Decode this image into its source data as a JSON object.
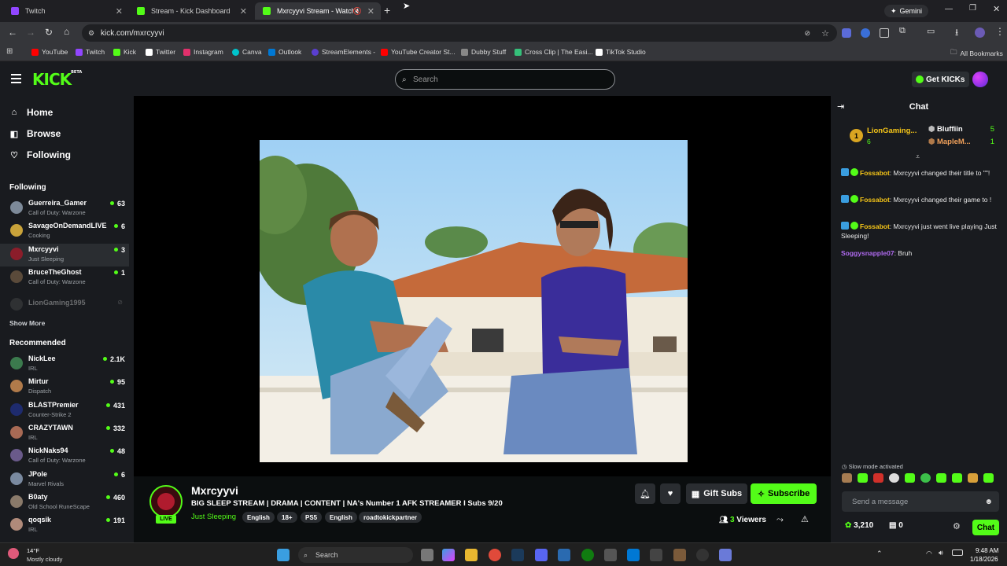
{
  "browser": {
    "tabs": [
      {
        "label": "Twitch",
        "color": "#9146ff"
      },
      {
        "label": "Stream - Kick Dashboard",
        "color": "#53fc18"
      },
      {
        "label": "Mxrcyyvi Stream - Watch Li",
        "color": "#53fc18"
      }
    ],
    "gemini_label": "Gemini",
    "url": "kick.com/mxrcyyvi",
    "bookmarks": [
      {
        "label": "YouTube",
        "color": "#ff0000"
      },
      {
        "label": "Twitch",
        "color": "#9146ff"
      },
      {
        "label": "Kick",
        "color": "#53fc18"
      },
      {
        "label": "Twitter",
        "color": "#ffffff"
      },
      {
        "label": "Instagram",
        "color": "#e1306c"
      },
      {
        "label": "Canva",
        "color": "#00c4cc"
      },
      {
        "label": "Outlook",
        "color": "#0078d4"
      },
      {
        "label": "StreamElements -",
        "color": "#5a3fd0"
      },
      {
        "label": "YouTube Creator St...",
        "color": "#ff0000"
      },
      {
        "label": "Dubby Stuff",
        "color": "#888888"
      },
      {
        "label": "Cross Clip | The Easi...",
        "color": "#35c07a"
      },
      {
        "label": "TikTok Studio",
        "color": "#ffffff"
      }
    ],
    "all_bookmarks": "All Bookmarks"
  },
  "kick": {
    "logo": "KICK",
    "logo_beta": "BETA",
    "search_placeholder": "Search",
    "get_kicks": "Get KICKs",
    "nav": {
      "home": "Home",
      "browse": "Browse",
      "following": "Following"
    },
    "following_header": "Following",
    "following": [
      {
        "name": "Guerreira_Gamer",
        "category": "Call of Duty: Warzone",
        "viewers": "63",
        "color": "#7d8a99"
      },
      {
        "name": "SavageOnDemandLIVE",
        "category": "Cooking",
        "viewers": "6",
        "color": "#c9a33a"
      },
      {
        "name": "Mxrcyyvi",
        "category": "Just Sleeping",
        "viewers": "3",
        "color": "#8b1d2a"
      },
      {
        "name": "BruceTheGhost",
        "category": "Call of Duty: Warzone",
        "viewers": "1",
        "color": "#5a4a3a"
      }
    ],
    "offline_channel": "LionGaming1995",
    "show_more": "Show More",
    "recommended_header": "Recommended",
    "recommended": [
      {
        "name": "NickLee",
        "category": "IRL",
        "viewers": "2.1K",
        "color": "#3b7a4d"
      },
      {
        "name": "Mirtur",
        "category": "Dispatch",
        "viewers": "95",
        "color": "#b07a4a"
      },
      {
        "name": "BLASTPremier",
        "category": "Counter-Strike 2",
        "viewers": "431",
        "color": "#1e2b6e"
      },
      {
        "name": "CRAZYTAWN",
        "category": "IRL",
        "viewers": "332",
        "color": "#a86a55"
      },
      {
        "name": "NickNaks94",
        "category": "Call of Duty: Warzone",
        "viewers": "48",
        "color": "#6a5a8a"
      },
      {
        "name": "JPole",
        "category": "Marvel Rivals",
        "viewers": "6",
        "color": "#7a8aa0"
      },
      {
        "name": "B0aty",
        "category": "Old School RuneScape",
        "viewers": "460",
        "color": "#8a7a6a"
      },
      {
        "name": "qoqsik",
        "category": "IRL",
        "viewers": "191",
        "color": "#b08a7a"
      }
    ],
    "stream": {
      "streamer": "Mxrcyyvi",
      "live_badge": "LIVE",
      "title": "BIG SLEEP STREAM | DRAMA | CONTENT | NA's Number 1 AFK STREAMER  I Subs 9/20",
      "category": "Just Sleeping",
      "tags": [
        "English",
        "18+",
        "PS5",
        "English",
        "roadtokickpartner"
      ],
      "gift_subs": "Gift Subs",
      "subscribe": "Subscribe",
      "viewers_count": "3",
      "viewers_label": "Viewers"
    },
    "chat": {
      "header": "Chat",
      "gifter_rank": "1",
      "gifter_name": "LionGaming...",
      "gifter_count": "6",
      "top_list": [
        {
          "name": "Bluffiin",
          "count": "5"
        },
        {
          "name": "MapleM...",
          "count": "1"
        }
      ],
      "messages": [
        {
          "user": "Fossabot",
          "text": "Mxrcyyvi changed their title to \"\"!"
        },
        {
          "user": "Fossabot",
          "text": "Mxrcyyvi changed their game to !"
        },
        {
          "user": "Fossabot",
          "text": "Mxrcyyvi just went live playing Just Sleeping!"
        },
        {
          "user": "Soggysnapple07",
          "text": "Bruh"
        }
      ],
      "slow_mode": "Slow mode activated",
      "send_placeholder": "Send a message",
      "points": "3,210",
      "pred_count": "0",
      "chat_button": "Chat"
    }
  },
  "taskbar": {
    "weather_temp": "14°F",
    "weather_desc": "Mostly cloudy",
    "search": "Search",
    "time": "9:48 AM",
    "date": "1/18/2026"
  },
  "colors": {
    "kick_green": "#53fc18",
    "panel": "#191b1f",
    "page": "#0b0e0f"
  }
}
